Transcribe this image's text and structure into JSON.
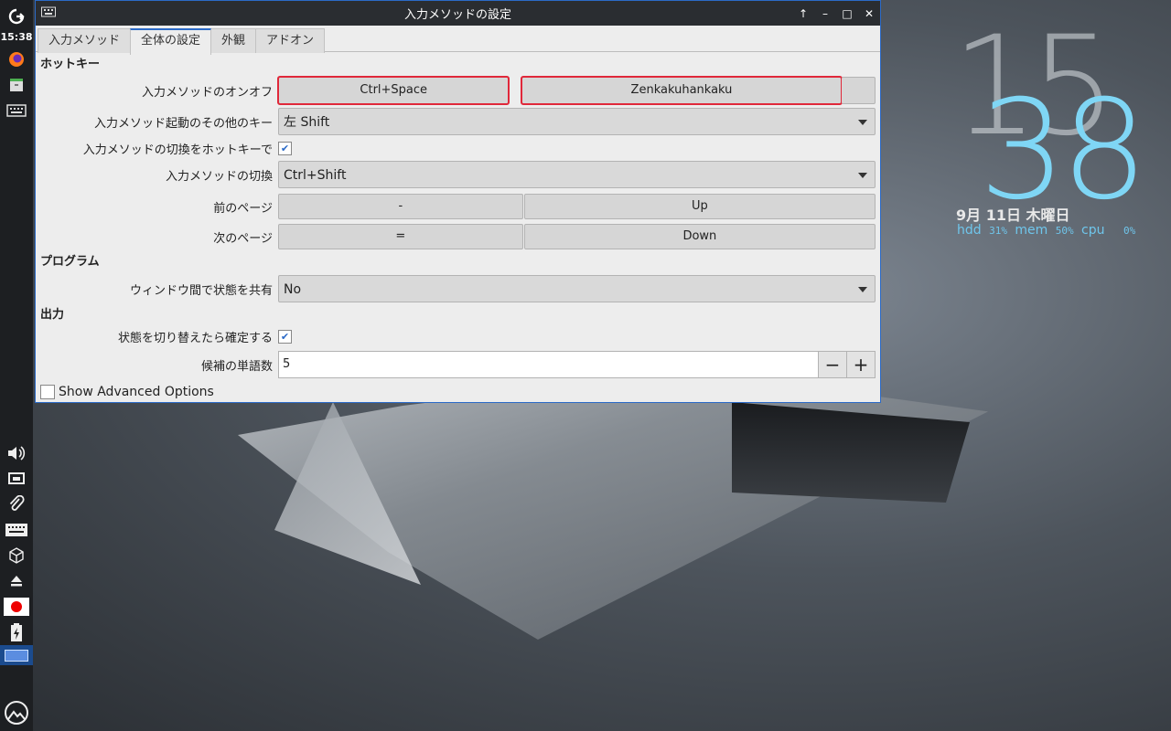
{
  "window": {
    "title": "入力メソッドの設定",
    "controls": [
      "↑",
      "–",
      "□",
      "✕"
    ]
  },
  "tabs": [
    {
      "label": "入力メソッド"
    },
    {
      "label": "全体の設定",
      "active": true
    },
    {
      "label": "外観"
    },
    {
      "label": "アドオン"
    }
  ],
  "sections": {
    "hotkey": "ホットキー",
    "program": "プログラム",
    "output": "出力"
  },
  "settings": {
    "toggle_label": "入力メソッドのオンオフ",
    "toggle_key1": "Ctrl+Space",
    "toggle_key2": "Zenkakuhankaku",
    "alt_key_label": "入力メソッド起動のその他のキー",
    "alt_key_value": "左 Shift",
    "switch_enable_label": "入力メソッドの切換をホットキーで",
    "switch_enable_checked": true,
    "switch_label": "入力メソッドの切換",
    "switch_value": "Ctrl+Shift",
    "prev_page_label": "前のページ",
    "prev_page_key1": "-",
    "prev_page_key2": "Up",
    "next_page_label": "次のページ",
    "next_page_key1": "=",
    "next_page_key2": "Down",
    "share_state_label": "ウィンドウ間で状態を共有",
    "share_state_value": "No",
    "commit_label": "状態を切り替えたら確定する",
    "commit_checked": true,
    "candidates_label": "候補の単語数",
    "candidates_value": "5",
    "advanced_label": "Show Advanced Options",
    "advanced_checked": false
  },
  "panel": {
    "clock": "15:38"
  },
  "clock_widget": {
    "hour": "15",
    "minute": "38",
    "date": "9月 11日 木曜日",
    "hdd_label": "hdd",
    "hdd_value": "31%",
    "mem_label": "mem",
    "mem_value": "50%",
    "cpu_label": "cpu",
    "cpu_value": "0%"
  },
  "colors": {
    "accent": "#2b6ac7",
    "highlight": "#e0283a",
    "clock_minute": "#7fd6f5"
  }
}
